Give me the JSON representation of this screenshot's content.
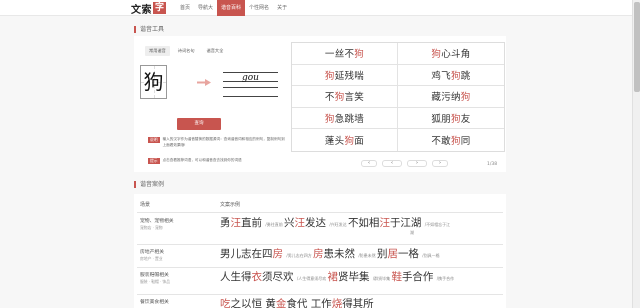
{
  "header": {
    "logo_text": "文索",
    "logo_box": "字",
    "nav": [
      {
        "label": "首页",
        "active": false
      },
      {
        "label": "导航大",
        "active": false
      },
      {
        "label": "谐音百科",
        "active": true
      },
      {
        "label": "个性网名",
        "active": false
      },
      {
        "label": "关于",
        "active": false
      }
    ]
  },
  "tool": {
    "section_title": "谐音工具",
    "tabs": [
      "常用谐音",
      "诗词名句",
      "谐音大全"
    ],
    "input_char": "狗",
    "pinyin": "gou",
    "query_label": "查询",
    "help_tag": "说明",
    "help_text": "输入的汉字作为谐音替换的数据源词：查询谐音词和相应的例句，复制例句到上面看效果哦!",
    "tip_tag": "提示",
    "tip_text": "点击查看推荐词语，可以和谐音查去找到你的词语"
  },
  "results": [
    {
      "pre": "一丝不",
      "hl": "狗",
      "post": ""
    },
    {
      "pre": "",
      "hl": "狗",
      "post": "心斗角"
    },
    {
      "pre": "",
      "hl": "狗",
      "post": "延残喘"
    },
    {
      "pre": "鸡飞",
      "hl": "狗",
      "post": "跳"
    },
    {
      "pre": "不",
      "hl": "狗",
      "post": "言笑"
    },
    {
      "pre": "藏污纳",
      "hl": "狗",
      "post": ""
    },
    {
      "pre": "",
      "hl": "狗",
      "post": "急跳墙"
    },
    {
      "pre": "狐朋",
      "hl": "狗",
      "post": "友"
    },
    {
      "pre": "蓬头",
      "hl": "狗",
      "post": "面"
    },
    {
      "pre": "不敢",
      "hl": "狗",
      "post": "同"
    }
  ],
  "pager": {
    "prev": "‹",
    "first": "‹",
    "next": "›",
    "last": "›",
    "page": "1/38"
  },
  "cases": {
    "section_title": "谐音案例",
    "col_scene": "场景",
    "col_example": "文案示例",
    "rows": [
      {
        "scene": "宠物、宠物相关",
        "tags": "宠物店 · 宠物",
        "example": [
          {
            "t": "勇",
            "c": false
          },
          {
            "t": "汪",
            "c": true
          },
          {
            "t": "直前 ",
            "c": false
          },
          {
            "t": "/勇往直前 ",
            "small": true
          },
          {
            "t": "兴",
            "c": false
          },
          {
            "t": "汪",
            "c": true
          },
          {
            "t": "发达 ",
            "c": false
          },
          {
            "t": "/兴旺发达 ",
            "small": true
          },
          {
            "t": "不如相",
            "c": false
          },
          {
            "t": "汪",
            "c": true
          },
          {
            "t": "于江湖 ",
            "c": false
          },
          {
            "t": "/不如相忘于江",
            "small": true
          }
        ],
        "extra": "湖"
      },
      {
        "scene": "房地产相关",
        "tags": "房地产 · 置业",
        "example": [
          {
            "t": "男儿志在四",
            "c": false
          },
          {
            "t": "房",
            "c": true
          },
          {
            "t": " ",
            "c": false
          },
          {
            "t": "/男儿志在四方 ",
            "small": true
          },
          {
            "t": "房",
            "c": true
          },
          {
            "t": "患未然 ",
            "c": false
          },
          {
            "t": "/防患未然 ",
            "small": true
          },
          {
            "t": "别",
            "c": false
          },
          {
            "t": "居",
            "c": true
          },
          {
            "t": "一格 ",
            "c": false
          },
          {
            "t": "/别具一格",
            "small": true
          }
        ],
        "extra": ""
      },
      {
        "scene": "服装鞋帽相关",
        "tags": "服装 · 鞋帽 · 饰品",
        "example": [
          {
            "t": "人生得",
            "c": false
          },
          {
            "t": "衣",
            "c": true
          },
          {
            "t": "须尽欢 ",
            "c": false
          },
          {
            "t": "/人生得意须尽欢 ",
            "small": true
          },
          {
            "t": "裙",
            "c": true
          },
          {
            "t": "贤毕集 ",
            "c": false
          },
          {
            "t": "/群贤毕集 ",
            "small": true
          },
          {
            "t": "鞋",
            "c": true
          },
          {
            "t": "手合作 ",
            "c": false
          },
          {
            "t": "/携手合作",
            "small": true
          }
        ],
        "extra": ""
      },
      {
        "scene": "餐饮美食相关",
        "tags": "",
        "example": [
          {
            "t": "",
            "c": false
          },
          {
            "t": "吃",
            "c": true
          },
          {
            "t": "之以恒 ",
            "c": false
          },
          {
            "t": "黄",
            "c": false
          },
          {
            "t": "金",
            "c": true
          },
          {
            "t": "食代 ",
            "c": false
          },
          {
            "t": "工作",
            "c": false
          },
          {
            "t": "烧",
            "c": true
          },
          {
            "t": "得其所",
            "c": false
          }
        ],
        "extra": ""
      }
    ]
  },
  "colors": {
    "accent": "#c8554f",
    "text": "#333333",
    "bg": "#f7f7f7"
  }
}
